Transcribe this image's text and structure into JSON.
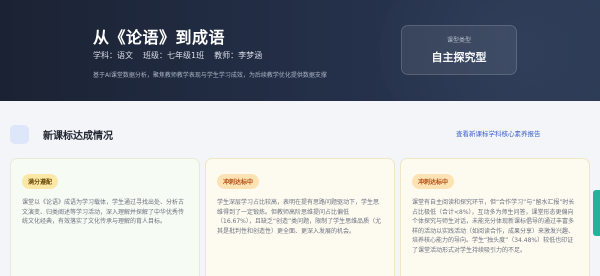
{
  "header": {
    "title": "从《论语》到成语",
    "meta": {
      "subject": "学科：语文",
      "grade": "班级：七年级1班",
      "teacher": "教师：李梦涵"
    },
    "description": "基于AI课堂数据分析，聚焦教师教学表现与学生学习成效，为后续教学优化提供数据支撑",
    "lesson_type": {
      "label": "课型类型",
      "value": "自主探究型"
    }
  },
  "section": {
    "title": "新课标达成情况",
    "link_label": "查看新课标学科核心素养报告"
  },
  "cards": [
    {
      "badge": "满分遵配",
      "text": "课堂以《论语》成语为学习载体，学生通过寻找出处、分析古文演变、归类阐述等学习活动，深入理解并探解了中华优秀传统文化经典，有效落实了文化传承与理解的育人目标。"
    },
    {
      "badge": "冲刺达标中",
      "text": "学生深层学习占比较高，表明在提有思路问题驱动下，学生思维得到了一定锻炼。但教师高阶思维提问占比偏低（16.67%），且缺乏“创造”类问题，限制了学生思维品质（尤其是批判性和创造性）更全面、更深入发展的机会。"
    },
    {
      "badge": "冲刺达标中",
      "text": "课堂有自主阅读和探究环节，但“合作学习”与“留水汇报”时长占比极低（合计<8%），互动多为师生问答，课堂形态更偏向个体探究与师生对话，未能充分体现新课标倡导的通过丰富多样的活动以实践活动（如阅读合作，成果分享）来激发兴趣、培养核心能力的导向。学生“独头度”（34.48%）较低也印证了课堂活动形式对学生持续吸引力的不足。"
    }
  ],
  "colors": {
    "header_bg": "#1b2233",
    "accent_link": "#3c61c8",
    "side_tab": "#23b39a"
  }
}
